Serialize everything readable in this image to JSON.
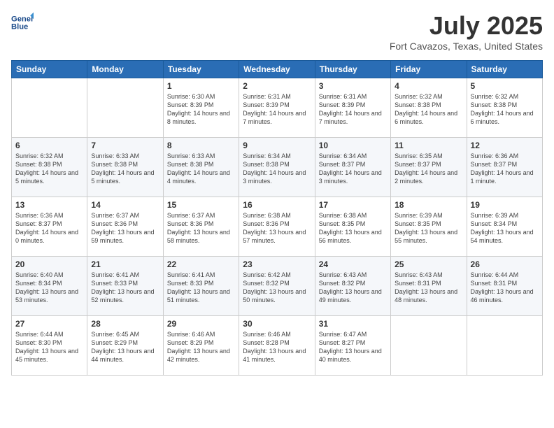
{
  "header": {
    "logo_line1": "General",
    "logo_line2": "Blue",
    "month": "July 2025",
    "location": "Fort Cavazos, Texas, United States"
  },
  "days_of_week": [
    "Sunday",
    "Monday",
    "Tuesday",
    "Wednesday",
    "Thursday",
    "Friday",
    "Saturday"
  ],
  "weeks": [
    [
      {
        "day": "",
        "info": ""
      },
      {
        "day": "",
        "info": ""
      },
      {
        "day": "1",
        "info": "Sunrise: 6:30 AM\nSunset: 8:39 PM\nDaylight: 14 hours and 8 minutes."
      },
      {
        "day": "2",
        "info": "Sunrise: 6:31 AM\nSunset: 8:39 PM\nDaylight: 14 hours and 7 minutes."
      },
      {
        "day": "3",
        "info": "Sunrise: 6:31 AM\nSunset: 8:39 PM\nDaylight: 14 hours and 7 minutes."
      },
      {
        "day": "4",
        "info": "Sunrise: 6:32 AM\nSunset: 8:38 PM\nDaylight: 14 hours and 6 minutes."
      },
      {
        "day": "5",
        "info": "Sunrise: 6:32 AM\nSunset: 8:38 PM\nDaylight: 14 hours and 6 minutes."
      }
    ],
    [
      {
        "day": "6",
        "info": "Sunrise: 6:32 AM\nSunset: 8:38 PM\nDaylight: 14 hours and 5 minutes."
      },
      {
        "day": "7",
        "info": "Sunrise: 6:33 AM\nSunset: 8:38 PM\nDaylight: 14 hours and 5 minutes."
      },
      {
        "day": "8",
        "info": "Sunrise: 6:33 AM\nSunset: 8:38 PM\nDaylight: 14 hours and 4 minutes."
      },
      {
        "day": "9",
        "info": "Sunrise: 6:34 AM\nSunset: 8:38 PM\nDaylight: 14 hours and 3 minutes."
      },
      {
        "day": "10",
        "info": "Sunrise: 6:34 AM\nSunset: 8:37 PM\nDaylight: 14 hours and 3 minutes."
      },
      {
        "day": "11",
        "info": "Sunrise: 6:35 AM\nSunset: 8:37 PM\nDaylight: 14 hours and 2 minutes."
      },
      {
        "day": "12",
        "info": "Sunrise: 6:36 AM\nSunset: 8:37 PM\nDaylight: 14 hours and 1 minute."
      }
    ],
    [
      {
        "day": "13",
        "info": "Sunrise: 6:36 AM\nSunset: 8:37 PM\nDaylight: 14 hours and 0 minutes."
      },
      {
        "day": "14",
        "info": "Sunrise: 6:37 AM\nSunset: 8:36 PM\nDaylight: 13 hours and 59 minutes."
      },
      {
        "day": "15",
        "info": "Sunrise: 6:37 AM\nSunset: 8:36 PM\nDaylight: 13 hours and 58 minutes."
      },
      {
        "day": "16",
        "info": "Sunrise: 6:38 AM\nSunset: 8:36 PM\nDaylight: 13 hours and 57 minutes."
      },
      {
        "day": "17",
        "info": "Sunrise: 6:38 AM\nSunset: 8:35 PM\nDaylight: 13 hours and 56 minutes."
      },
      {
        "day": "18",
        "info": "Sunrise: 6:39 AM\nSunset: 8:35 PM\nDaylight: 13 hours and 55 minutes."
      },
      {
        "day": "19",
        "info": "Sunrise: 6:39 AM\nSunset: 8:34 PM\nDaylight: 13 hours and 54 minutes."
      }
    ],
    [
      {
        "day": "20",
        "info": "Sunrise: 6:40 AM\nSunset: 8:34 PM\nDaylight: 13 hours and 53 minutes."
      },
      {
        "day": "21",
        "info": "Sunrise: 6:41 AM\nSunset: 8:33 PM\nDaylight: 13 hours and 52 minutes."
      },
      {
        "day": "22",
        "info": "Sunrise: 6:41 AM\nSunset: 8:33 PM\nDaylight: 13 hours and 51 minutes."
      },
      {
        "day": "23",
        "info": "Sunrise: 6:42 AM\nSunset: 8:32 PM\nDaylight: 13 hours and 50 minutes."
      },
      {
        "day": "24",
        "info": "Sunrise: 6:43 AM\nSunset: 8:32 PM\nDaylight: 13 hours and 49 minutes."
      },
      {
        "day": "25",
        "info": "Sunrise: 6:43 AM\nSunset: 8:31 PM\nDaylight: 13 hours and 48 minutes."
      },
      {
        "day": "26",
        "info": "Sunrise: 6:44 AM\nSunset: 8:31 PM\nDaylight: 13 hours and 46 minutes."
      }
    ],
    [
      {
        "day": "27",
        "info": "Sunrise: 6:44 AM\nSunset: 8:30 PM\nDaylight: 13 hours and 45 minutes."
      },
      {
        "day": "28",
        "info": "Sunrise: 6:45 AM\nSunset: 8:29 PM\nDaylight: 13 hours and 44 minutes."
      },
      {
        "day": "29",
        "info": "Sunrise: 6:46 AM\nSunset: 8:29 PM\nDaylight: 13 hours and 42 minutes."
      },
      {
        "day": "30",
        "info": "Sunrise: 6:46 AM\nSunset: 8:28 PM\nDaylight: 13 hours and 41 minutes."
      },
      {
        "day": "31",
        "info": "Sunrise: 6:47 AM\nSunset: 8:27 PM\nDaylight: 13 hours and 40 minutes."
      },
      {
        "day": "",
        "info": ""
      },
      {
        "day": "",
        "info": ""
      }
    ]
  ]
}
